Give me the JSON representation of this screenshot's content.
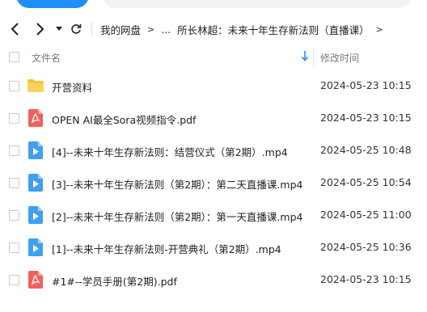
{
  "nav": {
    "breadcrumb_root": "我的网盘",
    "breadcrumb_ellipsis": "...",
    "breadcrumb_current": "所长林超：未来十年生存新法则（直播课）"
  },
  "columns": {
    "name": "文件名",
    "modified": "修改时间"
  },
  "files": [
    {
      "name": "开营资料",
      "modified": "2024-05-23 10:15",
      "icon": "folder-icon"
    },
    {
      "name": "OPEN AI最全Sora视频指令.pdf",
      "modified": "2024-05-23 10:15",
      "icon": "pdf-icon"
    },
    {
      "name": "[4]--未来十年生存新法则：结营仪式（第2期）.mp4",
      "modified": "2024-05-25 10:48",
      "icon": "video-icon"
    },
    {
      "name": "[3]--未来十年生存新法则（第2期）：第二天直播课.mp4",
      "modified": "2024-05-25 10:54",
      "icon": "video-icon"
    },
    {
      "name": "[2]--未来十年生存新法则（第2期）：第一天直播课.mp4",
      "modified": "2024-05-25 11:00",
      "icon": "video-icon"
    },
    {
      "name": "[1]--未来十年生存新法则-开营典礼（第2期）.mp4",
      "modified": "2024-05-25 10:36",
      "icon": "video-icon"
    },
    {
      "name": "#1#--学员手册(第2期).pdf",
      "modified": "2024-05-23 10:15",
      "icon": "pdf-icon"
    }
  ],
  "colors": {
    "accent": "#1e8ff7",
    "folder": "#f7c440",
    "pdf": "#f0605d",
    "video": "#3fa0f0"
  }
}
